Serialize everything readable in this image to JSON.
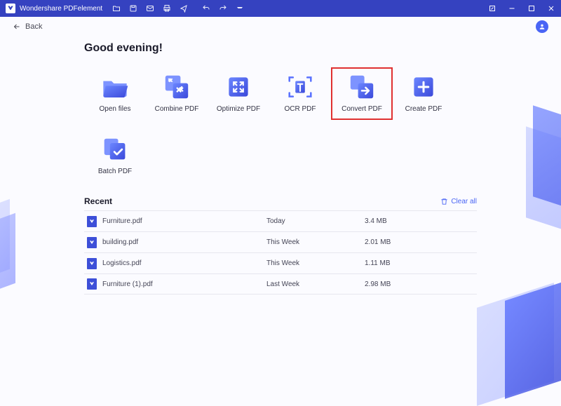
{
  "app": {
    "title": "Wondershare PDFelement"
  },
  "back": {
    "label": "Back"
  },
  "greeting": "Good evening!",
  "tiles": [
    {
      "label": "Open files",
      "icon": "folder-open-icon"
    },
    {
      "label": "Combine PDF",
      "icon": "combine-icon"
    },
    {
      "label": "Optimize PDF",
      "icon": "optimize-icon"
    },
    {
      "label": "OCR PDF",
      "icon": "ocr-icon"
    },
    {
      "label": "Convert PDF",
      "icon": "convert-icon",
      "highlight": true
    },
    {
      "label": "Create PDF",
      "icon": "create-icon"
    },
    {
      "label": "Batch PDF",
      "icon": "batch-icon"
    }
  ],
  "recent": {
    "title": "Recent",
    "clear_label": "Clear all",
    "items": [
      {
        "name": "Furniture.pdf",
        "time": "Today",
        "size": "3.4 MB"
      },
      {
        "name": "building.pdf",
        "time": "This Week",
        "size": "2.01 MB"
      },
      {
        "name": "Logistics.pdf",
        "time": "This Week",
        "size": "1.11 MB"
      },
      {
        "name": "Furniture (1).pdf",
        "time": "Last Week",
        "size": "2.98 MB"
      }
    ]
  }
}
